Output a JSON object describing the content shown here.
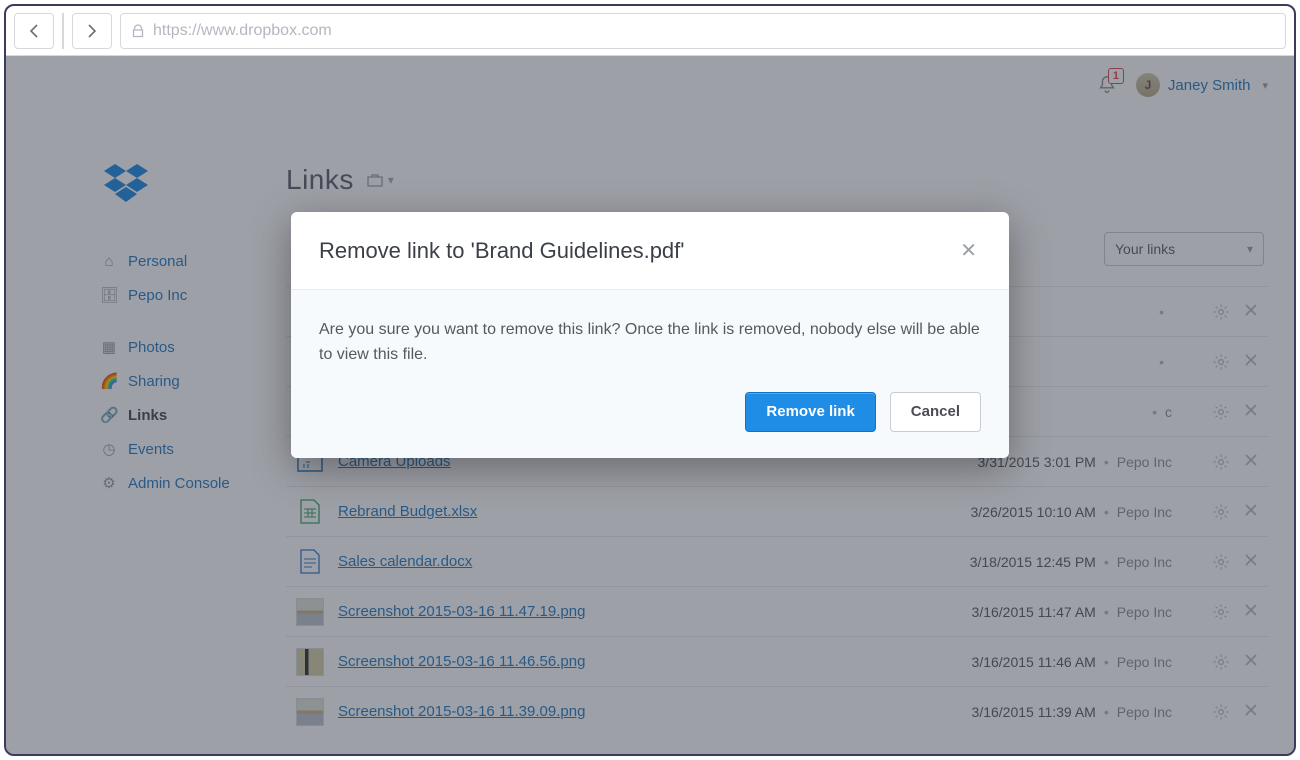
{
  "browser": {
    "url": "https://www.dropbox.com"
  },
  "topbar": {
    "notif_count": "1",
    "avatar_initial": "J",
    "username": "Janey Smith"
  },
  "sidebar": {
    "items": [
      {
        "label": "Personal"
      },
      {
        "label": "Pepo Inc"
      },
      {
        "label": "Photos"
      },
      {
        "label": "Sharing"
      },
      {
        "label": "Links"
      },
      {
        "label": "Events"
      },
      {
        "label": "Admin Console"
      }
    ]
  },
  "page": {
    "title": "Links",
    "filter_label": "Your links"
  },
  "files": [
    {
      "name": "",
      "date": "",
      "org": ""
    },
    {
      "name": "",
      "date": "",
      "org": ""
    },
    {
      "name": "",
      "date": "",
      "org": "c"
    },
    {
      "name": "Camera Uploads",
      "date": "3/31/2015 3:01 PM",
      "org": "Pepo Inc"
    },
    {
      "name": "Rebrand Budget.xlsx",
      "date": "3/26/2015 10:10 AM",
      "org": "Pepo Inc"
    },
    {
      "name": "Sales calendar.docx",
      "date": "3/18/2015 12:45 PM",
      "org": "Pepo Inc"
    },
    {
      "name": "Screenshot 2015-03-16 11.47.19.png",
      "date": "3/16/2015 11:47 AM",
      "org": "Pepo Inc"
    },
    {
      "name": "Screenshot 2015-03-16 11.46.56.png",
      "date": "3/16/2015 11:46 AM",
      "org": "Pepo Inc"
    },
    {
      "name": "Screenshot 2015-03-16 11.39.09.png",
      "date": "3/16/2015 11:39 AM",
      "org": "Pepo Inc"
    }
  ],
  "modal": {
    "title": "Remove link to 'Brand Guidelines.pdf'",
    "body": "Are you sure you want to remove this link? Once the link is removed, nobody else will be able to view this file.",
    "primary": "Remove link",
    "secondary": "Cancel"
  },
  "colors": {
    "accent": "#1f8ce6",
    "link": "#2b80c4"
  }
}
